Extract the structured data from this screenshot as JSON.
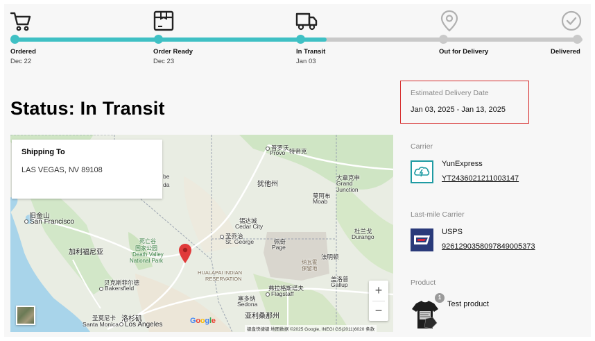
{
  "tracker": {
    "steps": [
      {
        "label": "Ordered",
        "date": "Dec 22",
        "state": "done",
        "icon": "cart-icon"
      },
      {
        "label": "Order Ready",
        "date": "Dec 23",
        "state": "done",
        "icon": "package-icon"
      },
      {
        "label": "In Transit",
        "date": "Jan 03",
        "state": "done",
        "icon": "truck-icon"
      },
      {
        "label": "Out for Delivery",
        "date": "",
        "state": "pending",
        "icon": "location-pin-icon"
      },
      {
        "label": "Delivered",
        "date": "",
        "state": "pending",
        "icon": "check-circle-icon"
      }
    ],
    "progress_fraction": 0.55,
    "colors": {
      "active": "#3fc0c4",
      "inactive": "#c9c9c9"
    }
  },
  "status": {
    "title": "Status: In Transit"
  },
  "shipping": {
    "title": "Shipping To",
    "address": "LAS VEGAS, NV 89108"
  },
  "map": {
    "labels": {
      "sf_cn": "旧金山",
      "sf": "San Francisco",
      "ca_cn": "加利福尼亚",
      "dv_cn": "死亡谷",
      "dv_cn2": "国家公园",
      "dv": "Death Valley",
      "dv2": "National Park",
      "bakers_cn": "贝克斯菲尔德",
      "bakers": "Bakersfield",
      "sm_cn": "圣莫尼卡",
      "sm": "Santa Monica",
      "la_cn": "洛杉矶",
      "la": "Los Angeles",
      "provo": "Provo",
      "provo_cn": "普罗沃",
      "provo_cn2": "特帝克",
      "utah_cn": "犹他州",
      "gj_cn": "大章克申",
      "gj": "Grand",
      "gj2": "Junction",
      "moab_cn": "莫阿布",
      "moab": "Moab",
      "cedar_cn": "锡达城",
      "cedar": "Cedar City",
      "stg_cn": "圣乔治",
      "stg": "St. George",
      "page_cn": "佩奇",
      "page": "Page",
      "durango_cn": "杜兰戈",
      "durango": "Durango",
      "navajo_cn": "纳瓦霍",
      "navajo_cn2": "保留地",
      "hualapai": "HUALAPAI INDIAN",
      "hualapai2": "RESERVATION",
      "flag_cn": "弗拉格斯塔夫",
      "flag": "Flagstaff",
      "sedona_cn": "塞多纳",
      "sedona": "Sedona",
      "gallup_cn": "盖洛普",
      "gallup": "Gallup",
      "az_cn": "亚利桑那州",
      "farm_cn": "法明顿",
      "be": "be",
      "da": "da"
    },
    "zoom_in": "+",
    "zoom_out": "−",
    "google": [
      "G",
      "o",
      "o",
      "g",
      "l",
      "e"
    ],
    "attribution": "键盘快捷键   地图数据 ©2025 Google, INEGI GS(2011)6020   条款"
  },
  "estimate": {
    "label": "Estimated Delivery Date",
    "value": "Jan 03, 2025 - Jan 13, 2025"
  },
  "carrier": {
    "label": "Carrier",
    "name": "YunExpress",
    "tracking": "YT2436021211003147"
  },
  "lastmile": {
    "label": "Last-mile Carrier",
    "name": "USPS",
    "tracking": "9261290358097849005373"
  },
  "product": {
    "label": "Product",
    "name": "Test product",
    "quantity": "1"
  }
}
